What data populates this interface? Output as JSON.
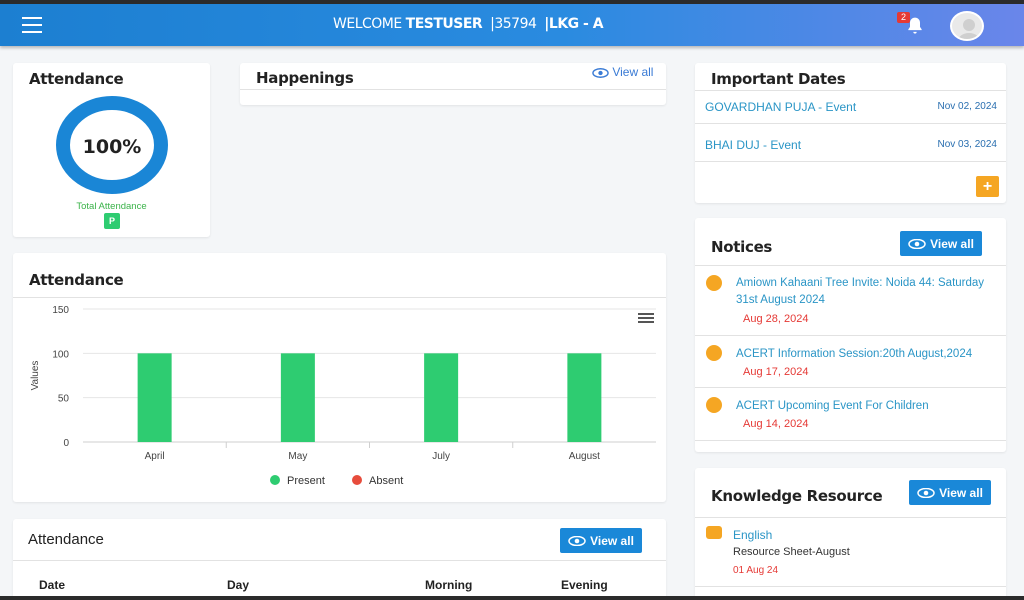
{
  "header": {
    "welcome_prefix": "WELCOME",
    "user": "TESTUSER",
    "id": "|35794",
    "class_label": "|LKG - A",
    "notification_count": "2"
  },
  "attendance_card": {
    "title": "Attendance",
    "percent_text": "100%",
    "percent_value": 100,
    "label": "Total Attendance",
    "status": "P"
  },
  "happenings": {
    "title": "Happenings",
    "view_all": "View all"
  },
  "important_dates": {
    "title": "Important Dates",
    "items": [
      {
        "name": "GOVARDHAN PUJA - Event",
        "date": "Nov 02, 2024"
      },
      {
        "name": "BHAI DUJ - Event",
        "date": "Nov 03, 2024"
      }
    ],
    "add_symbol": "+"
  },
  "notices": {
    "title": "Notices",
    "view_all": "View all",
    "items": [
      {
        "title": "Amiown Kahaani Tree Invite: Noida 44: Saturday 31st August 2024",
        "date": "Aug 28, 2024"
      },
      {
        "title": "ACERT Information Session:20th August,2024",
        "date": "Aug 17, 2024"
      },
      {
        "title": "ACERT Upcoming Event For Children",
        "date": "Aug 14, 2024"
      }
    ]
  },
  "knowledge": {
    "title": "Knowledge Resource",
    "view_all": "View all",
    "items": [
      {
        "subject": "English",
        "name": "Resource Sheet-August",
        "date": "01 Aug 24"
      }
    ]
  },
  "attendance_table": {
    "title": "Attendance",
    "view_all": "View all",
    "columns": [
      "Date",
      "Day",
      "Morning",
      "Evening"
    ]
  },
  "attendance_chart_title": "Attendance",
  "chart_data": {
    "type": "bar",
    "categories": [
      "April",
      "May",
      "July",
      "August"
    ],
    "series": [
      {
        "name": "Present",
        "values": [
          100,
          100,
          100,
          100
        ],
        "color": "#2ecc71"
      },
      {
        "name": "Absent",
        "values": [
          0,
          0,
          0,
          0
        ],
        "color": "#e74c3c"
      }
    ],
    "ylabel": "Values",
    "yticks": [
      0,
      50,
      100,
      150
    ],
    "ylim": [
      0,
      150
    ],
    "grid": true,
    "legend": "bottom"
  },
  "colors": {
    "topbar": "#1c7fd1",
    "accent": "#1a88d8",
    "present": "#2ecc71",
    "absent": "#e74c3c",
    "add": "#f5a623"
  }
}
